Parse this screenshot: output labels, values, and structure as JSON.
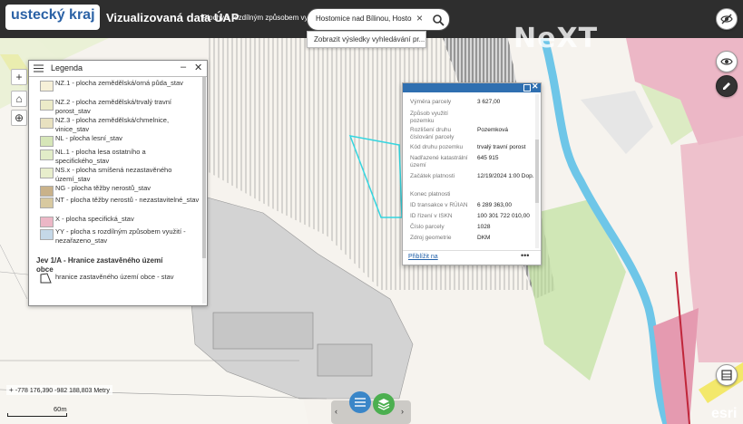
{
  "header": {
    "logo_text": "ustecký kraj",
    "app_title": "Vizualizovaná data ÚAP",
    "subtitle": "Plochy s rozdílným způsobem využití",
    "search_value": "Hostomice nad Bílinou, Hostomice",
    "search_suggestion": "Zobrazit výsledky vyhledávání pr...",
    "watermark": "NeXT"
  },
  "legend": {
    "title": "Legenda",
    "items": [
      {
        "label": "NZ.1 - plocha zemědělská/orná půda_stav",
        "color": "#f6f0d8"
      },
      {
        "label": "NZ.2 - plocha zemědělská/trvalý travní porost_stav",
        "color": "#ecebc8"
      },
      {
        "label": "NZ.3 - plocha zemědělská/chmelnice, vinice_stav",
        "color": "#e8e1c0"
      },
      {
        "label": "NL - plocha lesní_stav",
        "color": "#d6e6b8"
      },
      {
        "label": "NL.1 - plocha lesa ostatního a specifického_stav",
        "color": "#e2edc8"
      },
      {
        "label": "NS.x - plocha smíšená nezastavěného území_stav",
        "color": "#e8eecc"
      },
      {
        "label": "NG - plocha těžby nerostů_stav",
        "color": "#c9b28a"
      },
      {
        "label": "NT - plocha těžby nerostů - nezastavitelné_stav",
        "color": "#d8c9a0"
      },
      {
        "label": "X - plocha specifická_stav",
        "color": "#ecb7c6"
      },
      {
        "label": "YY - plocha s rozdílným způsobem využití - nezařazeno_stav",
        "color": "#c5d8e8"
      }
    ],
    "layer_title": "Jev 1/A - Hranice zastavěného území obce",
    "layer_item": "hranice zastavěného území obce - stav"
  },
  "popup": {
    "rows": [
      {
        "key": "Výměra parcely",
        "value": "3 627,00"
      },
      {
        "key": "Způsob využití pozemku",
        "value": ""
      },
      {
        "key": "Rozlišení druhu číslování parcely",
        "value": "Pozemková"
      },
      {
        "key": "Kód druhu pozemku",
        "value": "trvalý travní porost"
      },
      {
        "key": "Nadřazené katastrální území",
        "value": "645 915"
      },
      {
        "key": "Začátek platnosti",
        "value": "12/19/2024 1:00 Dop."
      },
      {
        "key": "Konec platnosti",
        "value": ""
      },
      {
        "key": "ID transakce v RÚIAN",
        "value": "6 289 363,00"
      },
      {
        "key": "ID řízení v ISKN",
        "value": "100 301 722 010,00"
      },
      {
        "key": "Číslo parcely",
        "value": "1028"
      },
      {
        "key": "Zdroj geometrie",
        "value": "DKM"
      }
    ],
    "link": "Přiblížit na",
    "more": "•••"
  },
  "footer": {
    "coordinates": "-778 176,390 -982 188,803 Metry",
    "scale": "60m",
    "esri": "esri"
  },
  "colors": {
    "header_bg": "#2e2e2e",
    "accent": "#2f6fb0",
    "river": "#6ec6e8",
    "pink_area": "#ecb7c6",
    "road_yellow": "#f3e86b"
  }
}
